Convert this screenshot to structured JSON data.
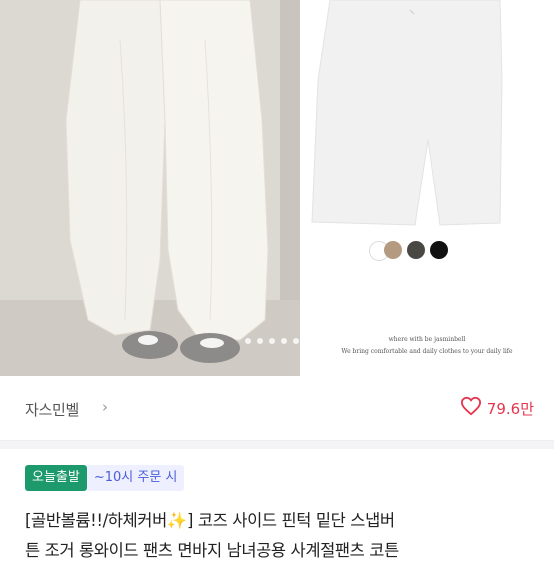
{
  "product": {
    "caption_line1": "where with be jasminbell",
    "caption_line2": "We bring comfortable and daily clothes to your daily life",
    "color_swatches": [
      "#ffffff",
      "#b39a80",
      "#4a4842",
      "#111111"
    ]
  },
  "seller": {
    "name": "자스민벨",
    "arrow": "›",
    "likes": "79.6만"
  },
  "badges": {
    "today": "오늘출발",
    "order_cutoff": "~10시 주문 시"
  },
  "title": {
    "line1": "[골반볼륨!!/하체커버✨] 코즈 사이드 핀턱 밑단 스냅버",
    "line2": "튼 조거 롱와이드 팬츠 면바지 남녀공용 사계절팬츠 코튼"
  }
}
